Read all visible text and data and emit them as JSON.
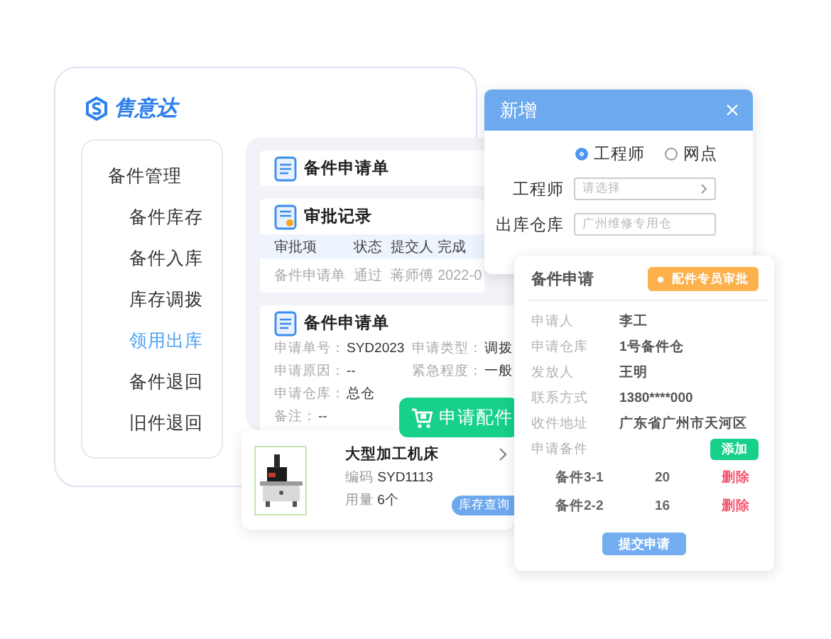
{
  "app": {
    "logo": "售意达"
  },
  "sidebar": {
    "items": [
      {
        "label": "备件管理",
        "children": [
          {
            "label": "备件库存",
            "selected": false
          },
          {
            "label": "备件入库",
            "selected": false
          },
          {
            "label": "库存调拨",
            "selected": false
          },
          {
            "label": "领用出库",
            "selected": true
          },
          {
            "label": "备件退回",
            "selected": false
          },
          {
            "label": "旧件退回",
            "selected": false
          }
        ]
      }
    ]
  },
  "request_header": {
    "title": "备件申请单"
  },
  "approval": {
    "title": "审批记录",
    "columns": [
      "审批项",
      "状态",
      "提交人",
      "完成"
    ],
    "rows": [
      [
        "备件申请单",
        "通过",
        "蒋师傅",
        "2022-0"
      ]
    ]
  },
  "request_detail": {
    "title": "备件申请单",
    "rows": [
      [
        {
          "label": "申请单号：",
          "value": "SYD2023"
        },
        {
          "label": "申请类型：",
          "value": "调拨"
        }
      ],
      [
        {
          "label": "申请原因：",
          "value": "--"
        },
        {
          "label": "紧急程度：",
          "value": "一般"
        }
      ],
      [
        {
          "label": "申请仓库：",
          "value": "总仓"
        }
      ],
      [
        {
          "label": "备注：",
          "value": "--"
        }
      ]
    ]
  },
  "apply_button": {
    "label": "申请配件"
  },
  "product": {
    "kind": "picture",
    "name": "大型加工机床",
    "code_label": "编码",
    "code": "SYD1113",
    "usage_label": "用量",
    "usage": "6个",
    "button": "库存查询"
  },
  "dialog": {
    "title": "新增",
    "radios": [
      {
        "label": "工程师",
        "selected": true
      },
      {
        "label": "网点",
        "selected": false
      }
    ],
    "fields": [
      {
        "label": "工程师",
        "placeholder": "请选择",
        "kind": "select"
      },
      {
        "label": "出库仓库",
        "placeholder": "广州维修专用仓",
        "kind": "text"
      }
    ]
  },
  "form": {
    "title": "备件申请",
    "badge": "配件专员审批",
    "rows": [
      {
        "label": "申请人",
        "value": "李工"
      },
      {
        "label": "申请仓库",
        "value": "1号备件仓"
      },
      {
        "label": "发放人",
        "value": "王明"
      },
      {
        "label": "联系方式",
        "value": "1380****000"
      },
      {
        "label": "收件地址",
        "value": "广东省广州市天河区"
      }
    ],
    "parts_label": "申请备件",
    "add_button": "添加",
    "parts": [
      {
        "name": "备件3-1",
        "qty": "20",
        "action": "删除"
      },
      {
        "name": "备件2-2",
        "qty": "16",
        "action": "删除"
      }
    ],
    "submit": "提交申请"
  }
}
